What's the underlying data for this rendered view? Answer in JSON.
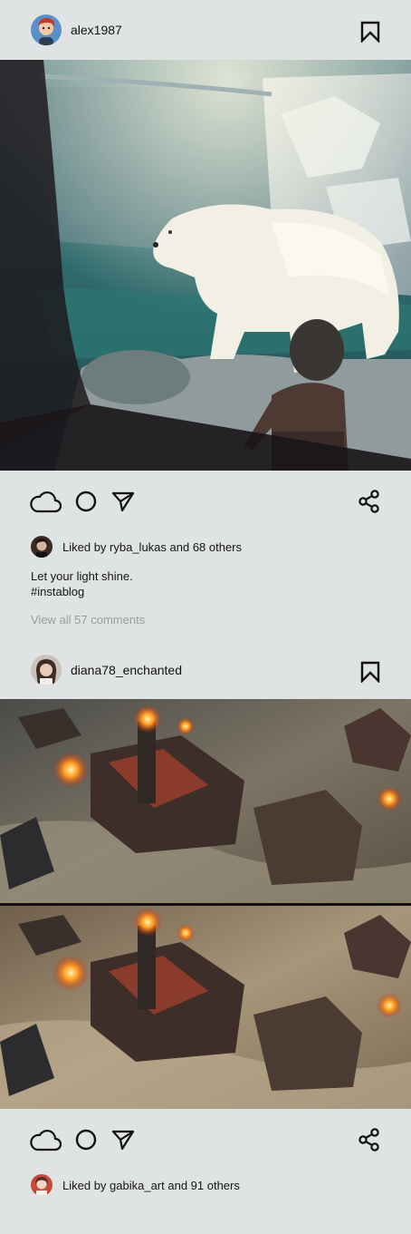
{
  "posts": [
    {
      "username": "alex1987",
      "liked_by_user": "ryba_lukas",
      "liked_text": "Liked by ryba_lukas and 68 others",
      "caption_line1": "Let your light shine.",
      "caption_line2": "#instablog",
      "comments_link": "View all 57 comments"
    },
    {
      "username": "diana78_enchanted",
      "liked_by_user": "gabika_art",
      "liked_text": "Liked by gabika_art and 91 others"
    }
  ],
  "icons": {
    "like": "cloud-icon",
    "comment": "circle-icon",
    "send": "paper-plane-icon",
    "share": "share-icon",
    "save": "bookmark-icon"
  },
  "colors": {
    "background": "#e0e3e3",
    "text": "#141414",
    "muted": "#9b9d9d"
  }
}
